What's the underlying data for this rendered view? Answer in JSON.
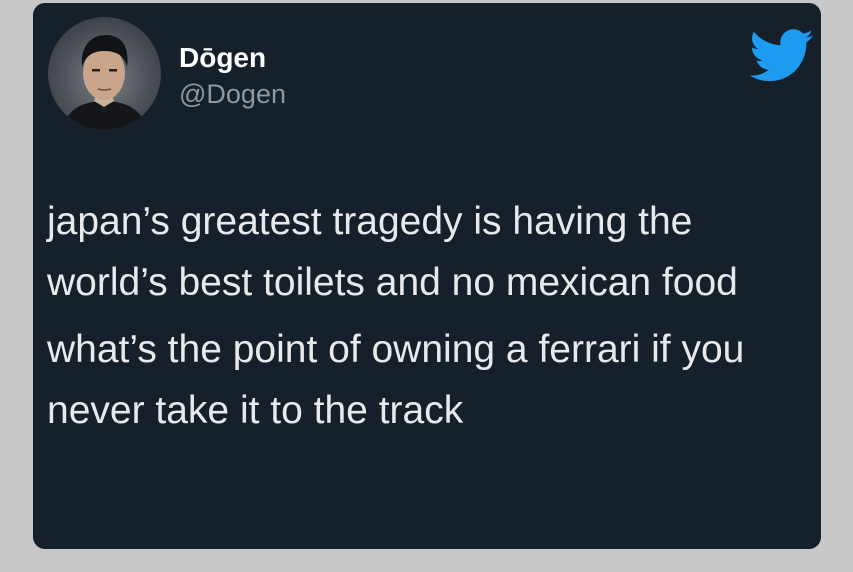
{
  "tweet": {
    "author": {
      "display_name": "Dōgen",
      "handle": "@Dogen"
    },
    "icons": {
      "avatar": "user-photo",
      "logo": "twitter-bird-icon"
    },
    "colors": {
      "card_background": "#15202b",
      "twitter_blue": "#1d9bf0",
      "page_background": "#c8c8c8"
    },
    "paragraphs": [
      "japan’s greatest tragedy is having the world’s best toilets and no mexican food",
      "what’s the point of owning a ferrari if you never take it to the track"
    ]
  }
}
